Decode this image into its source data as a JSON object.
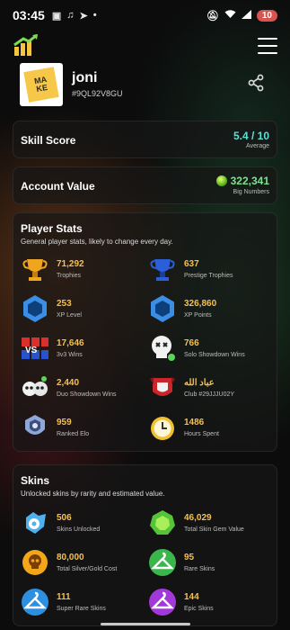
{
  "status_bar": {
    "time": "03:45",
    "icons": [
      "notification-icon",
      "music-icon",
      "telegram-icon",
      "dot-icon"
    ],
    "right_icons": [
      "mute-icon",
      "wifi-icon",
      "signal-icon"
    ],
    "battery": "10"
  },
  "header": {
    "logo_icon": "bar-chart-logo-icon",
    "menu_icon": "hamburger-menu-icon"
  },
  "profile": {
    "name": "joni",
    "tag": "#9QL92V8GU",
    "share_icon": "share-icon"
  },
  "skill_score": {
    "label": "Skill Score",
    "value": "5.4 / 10",
    "sub": "Average"
  },
  "account_value": {
    "label": "Account Value",
    "value": "322,341",
    "sub": "Big Numbers"
  },
  "player_stats": {
    "title": "Player Stats",
    "description": "General player stats, likely to change every day.",
    "items": [
      {
        "value": "71,292",
        "label": "Trophies",
        "icon": "trophy-icon"
      },
      {
        "value": "637",
        "label": "Prestige Trophies",
        "icon": "prestige-trophy-icon"
      },
      {
        "value": "253",
        "label": "XP Level",
        "icon": "xp-level-icon"
      },
      {
        "value": "326,860",
        "label": "XP Points",
        "icon": "xp-points-icon"
      },
      {
        "value": "17,646",
        "label": "3v3 Wins",
        "icon": "vs-icon"
      },
      {
        "value": "766",
        "label": "Solo Showdown Wins",
        "icon": "skull-icon"
      },
      {
        "value": "2,440",
        "label": "Duo Showdown Wins",
        "icon": "duo-skull-icon"
      },
      {
        "value": "عباد الله",
        "label": "Club #29JJJU02Y",
        "icon": "club-badge-icon"
      },
      {
        "value": "959",
        "label": "Ranked Elo",
        "icon": "ranked-icon"
      },
      {
        "value": "1486",
        "label": "Hours Spent",
        "icon": "clock-icon"
      }
    ]
  },
  "skins": {
    "title": "Skins",
    "description": "Unlocked skins by rarity and estimated value.",
    "items": [
      {
        "value": "506",
        "label": "Skins Unlocked",
        "icon": "skins-icon"
      },
      {
        "value": "46,029",
        "label": "Total Skin Gem Value",
        "icon": "gem-icon"
      },
      {
        "value": "80,000",
        "label": "Total Silver/Gold Cost",
        "icon": "coin-skull-icon"
      },
      {
        "value": "95",
        "label": "Rare Skins",
        "icon": "rare-hanger-icon"
      },
      {
        "value": "111",
        "label": "Super Rare Skins",
        "icon": "super-rare-hanger-icon"
      },
      {
        "value": "144",
        "label": "Epic Skins",
        "icon": "epic-hanger-icon"
      }
    ]
  }
}
